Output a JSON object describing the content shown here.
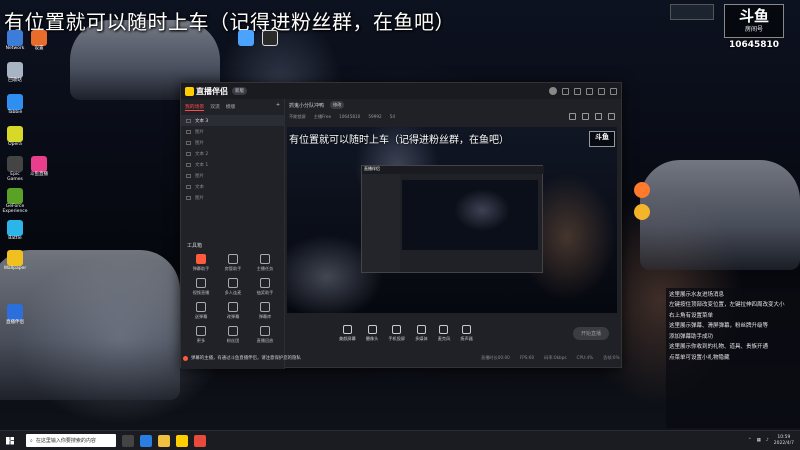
{
  "overlay": {
    "title": "有位置就可以随时上车（记得进粉丝群，在鱼吧）"
  },
  "logo": {
    "brand": "斗鱼",
    "sub": "房间号",
    "room_number": "10645810"
  },
  "app": {
    "name": "直播伴侣",
    "version": "新版",
    "sidebar_tabs": [
      "我的场景",
      "双流",
      "模版"
    ],
    "scenes": [
      "文本 3",
      "图片",
      "图片",
      "文本 2",
      "文本 1",
      "图片",
      "文本",
      "图片"
    ],
    "toolbox_title": "工具箱",
    "tools": [
      "弹幕助手",
      "房管助手",
      "主播任务",
      "视频直播",
      "多人连麦",
      "抽奖助手",
      "送弹幕",
      "改弹幕",
      "弹幕库",
      "更多",
      "粉丝团",
      "直播回放"
    ],
    "stream_title": "抓鬼小分队冲鸭",
    "stream_tag": "修改",
    "stream_meta": [
      "不能锁屏",
      "主播Free",
      "10645810",
      "59992",
      "54"
    ],
    "preview_title": "有位置就可以随时上车（记得进粉丝群，在鱼吧）",
    "preview_logo": "斗鱼",
    "bottom_tools": [
      "美颜屏幕",
      "摄像头",
      "手机投屏",
      "多媒体",
      "麦克风",
      "扬声器"
    ],
    "start_label": "开始直播",
    "notice": "弹幕的主播，有通过斗鱼直播伴侣，请注意保护您的隐私",
    "status": [
      "直播时长00:00",
      "FPS:60",
      "码率:0kbps",
      "CPU:4%",
      "丢帧:0%"
    ]
  },
  "chat": {
    "messages": [
      "这里展示水友进场消息",
      "左键按住顶部改变位置，左键拉伸四周改变大小",
      "右上角有设置菜单",
      "这里展示弹幕、滑屏弹幕，粉丝牌升级等",
      "添加弹幕助手成功",
      "这里展示你收到的礼物、道具、贵族开通",
      "点菜单可设置小礼物隐藏"
    ]
  },
  "desktop": {
    "icons": [
      "Network",
      "设置",
      "回收站",
      "Tabbie",
      "Opera",
      "Epic Games",
      "GeForce Experience",
      "斗鱼直播",
      "Battle",
      "Wallpaper",
      "直播伴侣"
    ]
  },
  "taskbar": {
    "search_placeholder": "在这里输入你要搜索的内容",
    "time": "10:59",
    "date": "2022/4/7"
  },
  "colors": {
    "accent": "#ff4a4a",
    "brand_yellow": "#ffce00",
    "panel_bg": "#1f2127"
  }
}
